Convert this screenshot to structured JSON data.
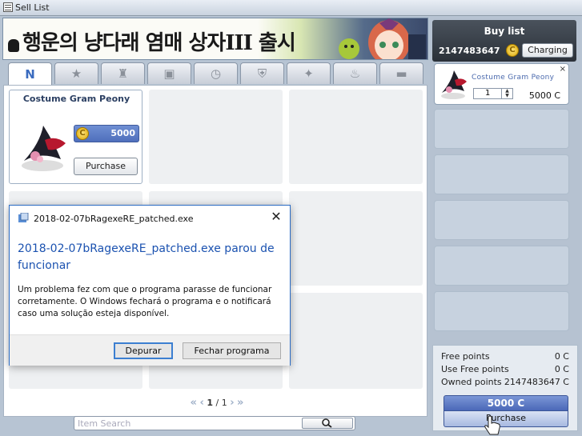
{
  "window": {
    "title": "Sell List"
  },
  "banner": {
    "text": "행운의 냥다래 염매 상자III 출시"
  },
  "tabs": [
    {
      "label": "N",
      "icon": "new-icon"
    },
    {
      "label": "",
      "icon": "star-icon"
    },
    {
      "label": "",
      "icon": "costume-icon"
    },
    {
      "label": "",
      "icon": "box-icon"
    },
    {
      "label": "",
      "icon": "clock-icon"
    },
    {
      "label": "",
      "icon": "shield-icon"
    },
    {
      "label": "",
      "icon": "sparkle-icon"
    },
    {
      "label": "",
      "icon": "potion-icon"
    },
    {
      "label": "",
      "icon": "folder-icon"
    }
  ],
  "item": {
    "name": "Costume Gram Peony",
    "price": "5000",
    "coin_symbol": "C",
    "purchase_label": "Purchase"
  },
  "pager": {
    "current": "1",
    "separator": "/",
    "total": "1"
  },
  "search": {
    "placeholder": "Item Search"
  },
  "buy_list": {
    "title": "Buy list",
    "points": "2147483647",
    "coin_symbol": "C",
    "charging_label": "Charging",
    "cart": [
      {
        "name": "Costume Gram Peony",
        "qty": "1",
        "price": "5000 C",
        "close": "×"
      }
    ]
  },
  "summary": {
    "free_points_label": "Free points",
    "free_points_value": "0 C",
    "use_free_points_label": "Use Free points",
    "use_free_points_value": "0 C",
    "owned_points_label": "Owned points",
    "owned_points_value": "2147483647 C",
    "total": "5000 C",
    "purchase_label": "Purchase"
  },
  "dialog": {
    "title": "2018-02-07bRagexeRE_patched.exe",
    "close": "✕",
    "heading": "2018-02-07bRagexeRE_patched.exe parou de funcionar",
    "body": "Um problema fez com que o programa parasse de funcionar corretamente. O Windows fechará o programa e o notificará caso uma solução esteja disponível.",
    "debug_label": "Depurar",
    "close_program_label": "Fechar programa"
  },
  "colors": {
    "accent": "#3a6bbf",
    "dialog_link": "#1b52b0",
    "price_bg": "#5a78c4"
  }
}
